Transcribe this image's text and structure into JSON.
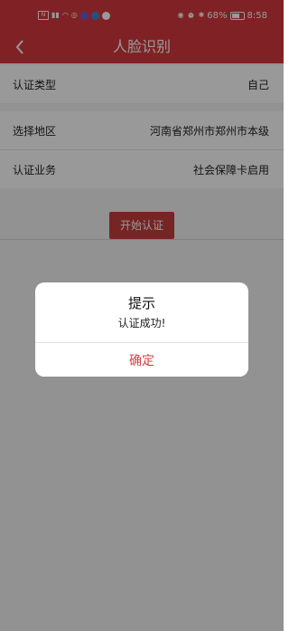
{
  "status_bar": {
    "left_icons": [
      "nfc-icon",
      "signal-icon",
      "wifi-icon",
      "hotspot-icon",
      "app-icon",
      "app-icon",
      "app-icon"
    ],
    "battery": "68%",
    "time": "8:58"
  },
  "header": {
    "title": "人脸识别",
    "back_icon": "chevron-left-icon"
  },
  "form": {
    "auth_type": {
      "label": "认证类型",
      "value": "自己"
    },
    "region": {
      "label": "选择地区",
      "value": "河南省郑州市郑州市本级"
    },
    "business": {
      "label": "认证业务",
      "value": "社会保障卡启用"
    }
  },
  "start_button": {
    "label": "开始认证"
  },
  "dialog": {
    "title": "提示",
    "message": "认证成功!",
    "confirm": "确定"
  },
  "colors": {
    "brand_red": "#d53a3f",
    "button_red": "#c73d3f",
    "dialog_confirm": "#d54040"
  }
}
